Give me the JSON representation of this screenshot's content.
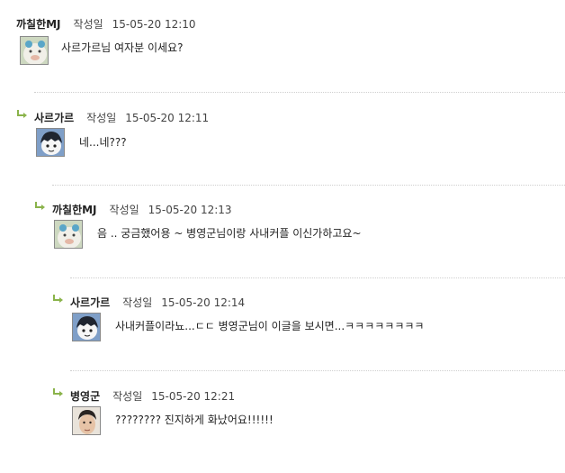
{
  "comments": [
    {
      "author": "까칠한MJ",
      "date_label": "작성일",
      "date": "15-05-20 12:10",
      "text": "사르가르님 여자분 이세요?",
      "avatar": "cat-mj-avatar"
    },
    {
      "author": "사르가르",
      "date_label": "작성일",
      "date": "15-05-20 12:11",
      "text": "네...네???",
      "avatar": "dark-hair-cartoon-avatar"
    },
    {
      "author": "까칠한MJ",
      "date_label": "작성일",
      "date": "15-05-20 12:13",
      "text": "음 .. 궁금했어용 ~ 병영군님이랑 사내커플 이신가하고요~",
      "avatar": "cat-mj-avatar"
    },
    {
      "author": "사르가르",
      "date_label": "작성일",
      "date": "15-05-20 12:14",
      "text": "사내커플이라뇨...ㄷㄷ 병영군님이 이글을 보시면...ㅋㅋㅋㅋㅋㅋㅋㅋ",
      "avatar": "dark-hair-cartoon-avatar"
    },
    {
      "author": "병영군",
      "date_label": "작성일",
      "date": "15-05-20 12:21",
      "text": "???????? 진지하게 화났어요!!!!!!",
      "avatar": "man-face-avatar"
    }
  ],
  "colors": {
    "reply_arrow": "#8ab34a",
    "divider": "#cfcfcf"
  }
}
